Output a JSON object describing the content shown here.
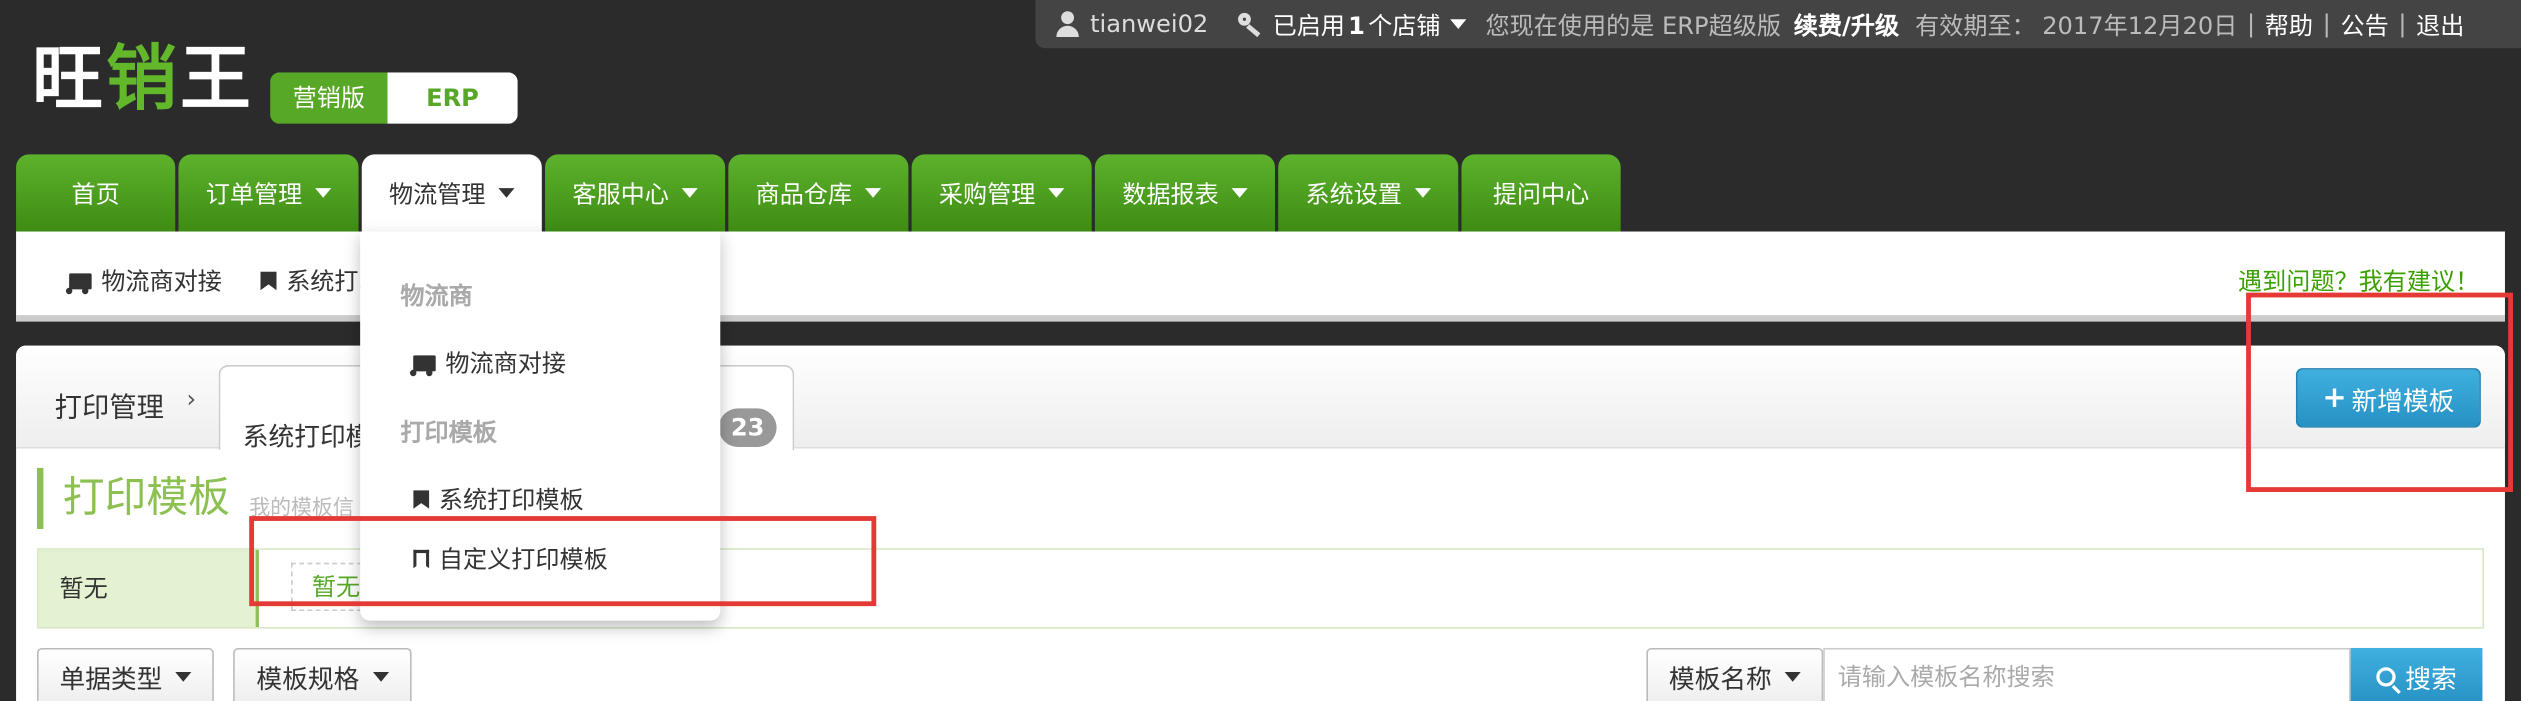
{
  "topbar": {
    "username": "tianwei02",
    "store_prefix": "已启用",
    "store_count": "1",
    "store_suffix": "个店铺",
    "version_text": "您现在使用的是 ERP超级版",
    "renew_label": "续费/升级",
    "expiry_label": "有效期至：",
    "expiry_date": "2017年12月20日",
    "help_label": "帮助",
    "notice_label": "公告",
    "logout_label": "退出",
    "separator": "|"
  },
  "logo": {
    "part1": "旺",
    "part2": "销",
    "part3": "王"
  },
  "edition": {
    "marketing": "营销版",
    "erp": "ERP"
  },
  "nav": {
    "tabs": [
      {
        "label": "首页",
        "dropdown": false
      },
      {
        "label": "订单管理",
        "dropdown": true
      },
      {
        "label": "物流管理",
        "dropdown": true,
        "active": true
      },
      {
        "label": "客服中心",
        "dropdown": true
      },
      {
        "label": "商品仓库",
        "dropdown": true
      },
      {
        "label": "采购管理",
        "dropdown": true
      },
      {
        "label": "数据报表",
        "dropdown": true
      },
      {
        "label": "系统设置",
        "dropdown": true
      },
      {
        "label": "提问中心",
        "dropdown": false
      }
    ]
  },
  "subnav": {
    "items": [
      {
        "label": "物流商对接",
        "icon": "truck-icon"
      },
      {
        "label": "系统打印",
        "icon": "bookmark-icon"
      }
    ],
    "feedback": "遇到问题？我有建议！"
  },
  "dropdown": {
    "group1": "物流商",
    "item1": "物流商对接",
    "group2": "打印模板",
    "item2": "系统打印模板",
    "item3": "自定义打印模板"
  },
  "panel": {
    "breadcrumb": "打印管理",
    "breadcrumb_arrow": "›",
    "tab_label": "系统打印模",
    "tab_badge": "23",
    "add_button": "新增模板",
    "section_title": "打印模板",
    "section_sub": "我的模板信",
    "category_label": "暂无",
    "category_chip": "暂无",
    "filters": {
      "doc_type": "单据类型",
      "template_spec": "模板规格",
      "template_name": "模板名称"
    },
    "search_placeholder": "请输入模板名称搜索",
    "search_button": "搜索"
  },
  "colors": {
    "brand_green": "#58a827",
    "accent_blue": "#2b9ed4",
    "annotation_red": "#e53935"
  }
}
